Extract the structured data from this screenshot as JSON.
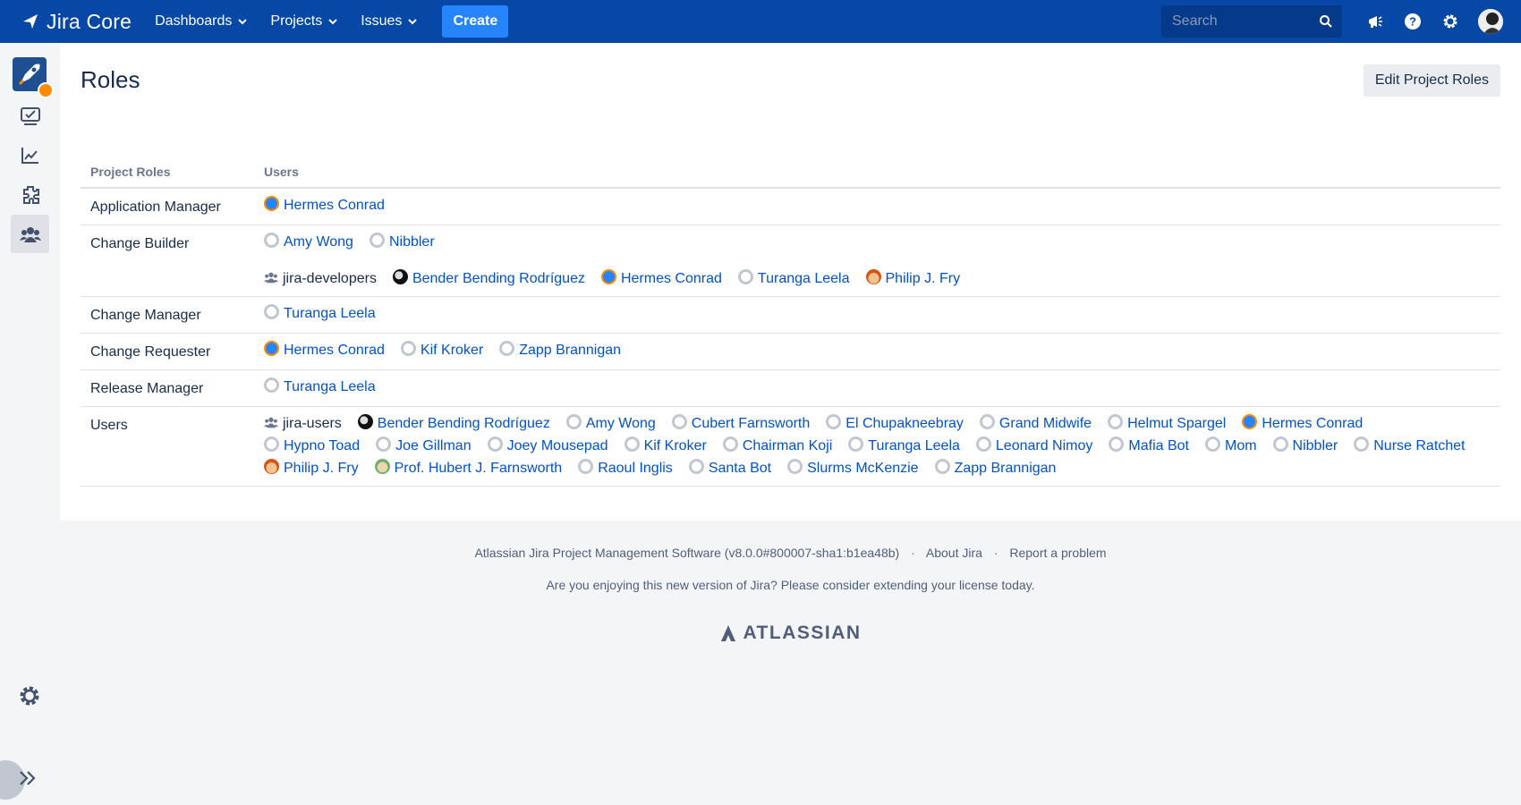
{
  "topnav": {
    "logo_text": "Jira Core",
    "menu": [
      {
        "label": "Dashboards"
      },
      {
        "label": "Projects"
      },
      {
        "label": "Issues"
      }
    ],
    "create_label": "Create",
    "search_placeholder": "Search",
    "icons": [
      "megaphone-icon",
      "help-icon",
      "gear-icon",
      "user-avatar"
    ]
  },
  "sidebar": {
    "items": [
      "project-avatar",
      "issues-icon",
      "reports-icon",
      "add-ons-icon",
      "users-roles-icon"
    ],
    "active": "users-roles-icon",
    "bottom": [
      "settings-icon",
      "expand-icon"
    ]
  },
  "page": {
    "title": "Roles",
    "edit_button": "Edit Project Roles",
    "table_headers": {
      "roles": "Project Roles",
      "users": "Users"
    },
    "rows": [
      {
        "role": "Application Manager",
        "lines": [
          [
            {
              "type": "user",
              "name": "Hermes Conrad",
              "avatar": "hermes"
            }
          ]
        ]
      },
      {
        "role": "Change Builder",
        "lines": [
          [
            {
              "type": "user",
              "name": "Amy Wong",
              "avatar": "default"
            },
            {
              "type": "user",
              "name": "Nibbler",
              "avatar": "default"
            }
          ],
          [
            {
              "type": "group",
              "name": "jira-developers"
            },
            {
              "type": "user",
              "name": "Bender Bending Rodríguez",
              "avatar": "bender"
            },
            {
              "type": "user",
              "name": "Hermes Conrad",
              "avatar": "hermes"
            },
            {
              "type": "user",
              "name": "Turanga Leela",
              "avatar": "default"
            },
            {
              "type": "user",
              "name": "Philip J. Fry",
              "avatar": "fry"
            }
          ]
        ]
      },
      {
        "role": "Change Manager",
        "lines": [
          [
            {
              "type": "user",
              "name": "Turanga Leela",
              "avatar": "default"
            }
          ]
        ]
      },
      {
        "role": "Change Requester",
        "lines": [
          [
            {
              "type": "user",
              "name": "Hermes Conrad",
              "avatar": "hermes"
            },
            {
              "type": "user",
              "name": "Kif Kroker",
              "avatar": "default"
            },
            {
              "type": "user",
              "name": "Zapp Brannigan",
              "avatar": "default"
            }
          ]
        ]
      },
      {
        "role": "Release Manager",
        "lines": [
          [
            {
              "type": "user",
              "name": "Turanga Leela",
              "avatar": "default"
            }
          ]
        ]
      },
      {
        "role": "Users",
        "lines": [
          [
            {
              "type": "group",
              "name": "jira-users"
            },
            {
              "type": "user",
              "name": "Bender Bending Rodríguez",
              "avatar": "bender"
            },
            {
              "type": "user",
              "name": "Amy Wong",
              "avatar": "default"
            },
            {
              "type": "user",
              "name": "Cubert Farnsworth",
              "avatar": "default"
            },
            {
              "type": "user",
              "name": "El Chupakneebray",
              "avatar": "default"
            },
            {
              "type": "user",
              "name": "Grand Midwife",
              "avatar": "default"
            },
            {
              "type": "user",
              "name": "Helmut Spargel",
              "avatar": "default"
            },
            {
              "type": "user",
              "name": "Hermes Conrad",
              "avatar": "hermes"
            },
            {
              "type": "user",
              "name": "Hypno Toad",
              "avatar": "default"
            },
            {
              "type": "user",
              "name": "Joe Gillman",
              "avatar": "default"
            },
            {
              "type": "user",
              "name": "Joey Mousepad",
              "avatar": "default"
            },
            {
              "type": "user",
              "name": "Kif Kroker",
              "avatar": "default"
            },
            {
              "type": "user",
              "name": "Chairman Koji",
              "avatar": "default"
            },
            {
              "type": "user",
              "name": "Turanga Leela",
              "avatar": "default"
            },
            {
              "type": "user",
              "name": "Leonard Nimoy",
              "avatar": "default"
            },
            {
              "type": "user",
              "name": "Mafia Bot",
              "avatar": "default"
            },
            {
              "type": "user",
              "name": "Mom",
              "avatar": "default"
            },
            {
              "type": "user",
              "name": "Nibbler",
              "avatar": "default"
            },
            {
              "type": "user",
              "name": "Nurse Ratchet",
              "avatar": "default"
            },
            {
              "type": "user",
              "name": "Philip J. Fry",
              "avatar": "fry"
            },
            {
              "type": "user",
              "name": "Prof. Hubert J. Farnsworth",
              "avatar": "prof"
            },
            {
              "type": "user",
              "name": "Raoul Inglis",
              "avatar": "default"
            },
            {
              "type": "user",
              "name": "Santa Bot",
              "avatar": "default"
            },
            {
              "type": "user",
              "name": "Slurms McKenzie",
              "avatar": "default"
            },
            {
              "type": "user",
              "name": "Zapp Brannigan",
              "avatar": "default"
            }
          ]
        ]
      }
    ]
  },
  "footer": {
    "software": "Atlassian Jira Project Management Software (v8.0.0#800007-sha1:b1ea48b)",
    "about": "About Jira",
    "report": "Report a problem",
    "message": "Are you enjoying this new version of Jira? Please consider extending your license today.",
    "logo_text": "ATLASSIAN"
  },
  "colors": {
    "nav": "#0747a6",
    "link": "#0052cc",
    "create": "#2684ff"
  }
}
